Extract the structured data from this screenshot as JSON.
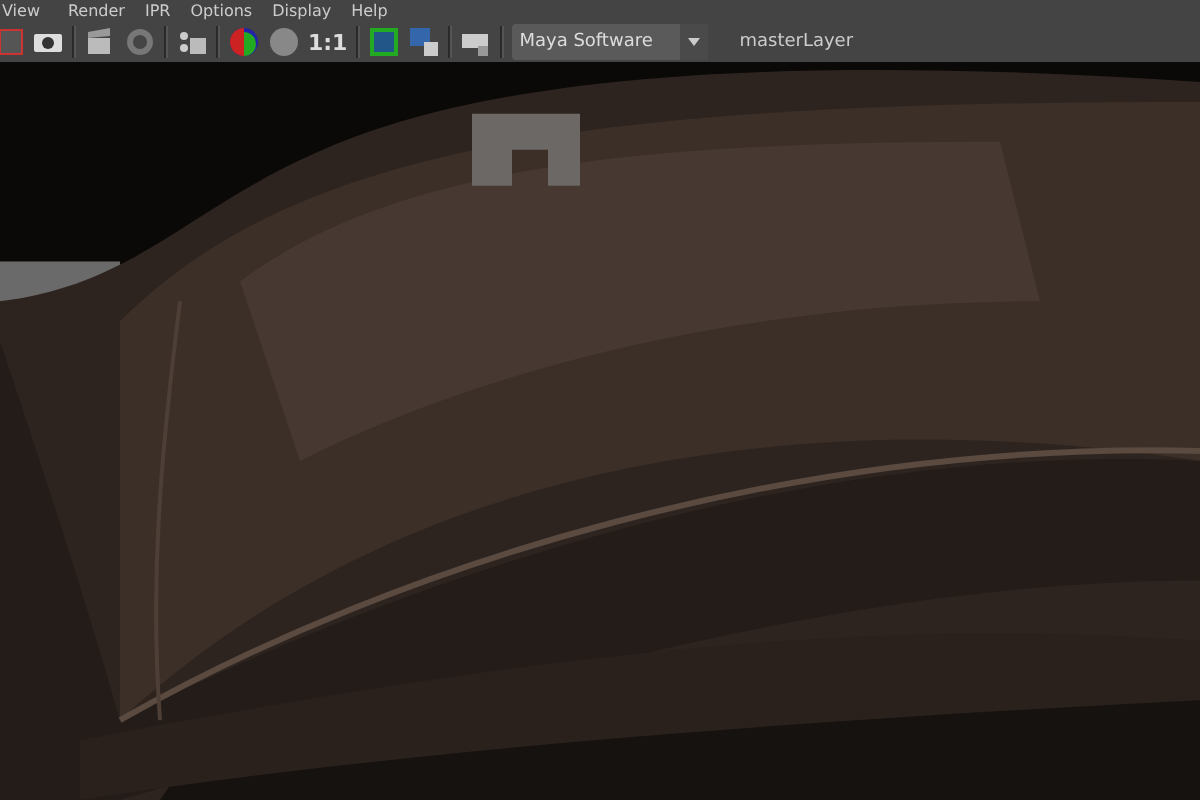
{
  "menu_bar": {
    "items": [
      "View",
      "Render",
      "IPR",
      "Options",
      "Display",
      "Help"
    ]
  },
  "toolbar": {
    "ratio_label": "1:1",
    "renderer": "Maya Software",
    "layer": "masterLayer"
  }
}
